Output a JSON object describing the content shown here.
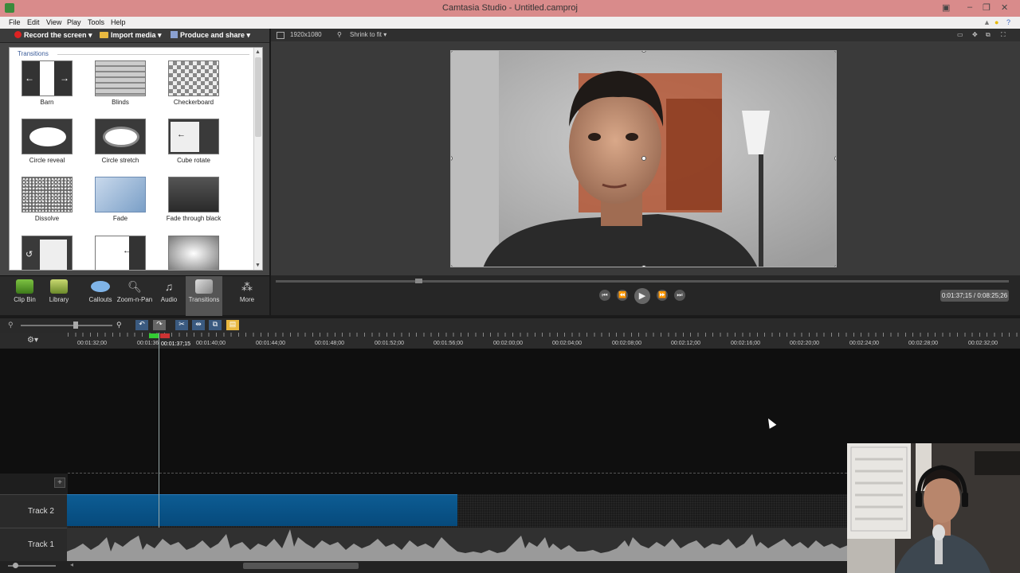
{
  "window": {
    "title": "Camtasia Studio - Untitled.camproj"
  },
  "menu": [
    "File",
    "Edit",
    "View",
    "Play",
    "Tools",
    "Help"
  ],
  "toolbar": {
    "record": "Record the screen",
    "import": "Import media",
    "produce": "Produce and share"
  },
  "transitions": {
    "header": "Transitions",
    "items": [
      "Barn",
      "Blinds",
      "Checkerboard",
      "Circle reveal",
      "Circle stretch",
      "Cube rotate",
      "Dissolve",
      "Fade",
      "Fade through black"
    ]
  },
  "tabs": [
    {
      "label": "Clip Bin",
      "icon": "film-icon"
    },
    {
      "label": "Library",
      "icon": "library-icon"
    },
    {
      "label": "Callouts",
      "icon": "callout-icon"
    },
    {
      "label": "Zoom-n-Pan",
      "icon": "zoom-icon"
    },
    {
      "label": "Audio",
      "icon": "audio-icon"
    },
    {
      "label": "Transitions",
      "icon": "transitions-icon",
      "active": true
    },
    {
      "label": "More",
      "icon": "more-icon"
    }
  ],
  "preview": {
    "resolution": "1920x1080",
    "zoom": "Shrink to fit"
  },
  "playback": {
    "timecode": "0:01:37;15 / 0:08:25;26"
  },
  "timeline": {
    "ruler": [
      "00:01:32;00",
      "00:01:36",
      "00:01:37;15",
      "00:01:40;00",
      "00:01:44;00",
      "00:01:48;00",
      "00:01:52;00",
      "00:01:56;00",
      "00:02:00;00",
      "00:02:04;00",
      "00:02:08;00",
      "00:02:12;00",
      "00:02:16;00",
      "00:02:20;00",
      "00:02:24;00",
      "00:02:28;00",
      "00:02:32;00"
    ],
    "tracks": [
      "Track 2",
      "Track 1"
    ]
  },
  "colors": {
    "accent": "#0d5c93",
    "titlebar": "#d98b8b"
  }
}
